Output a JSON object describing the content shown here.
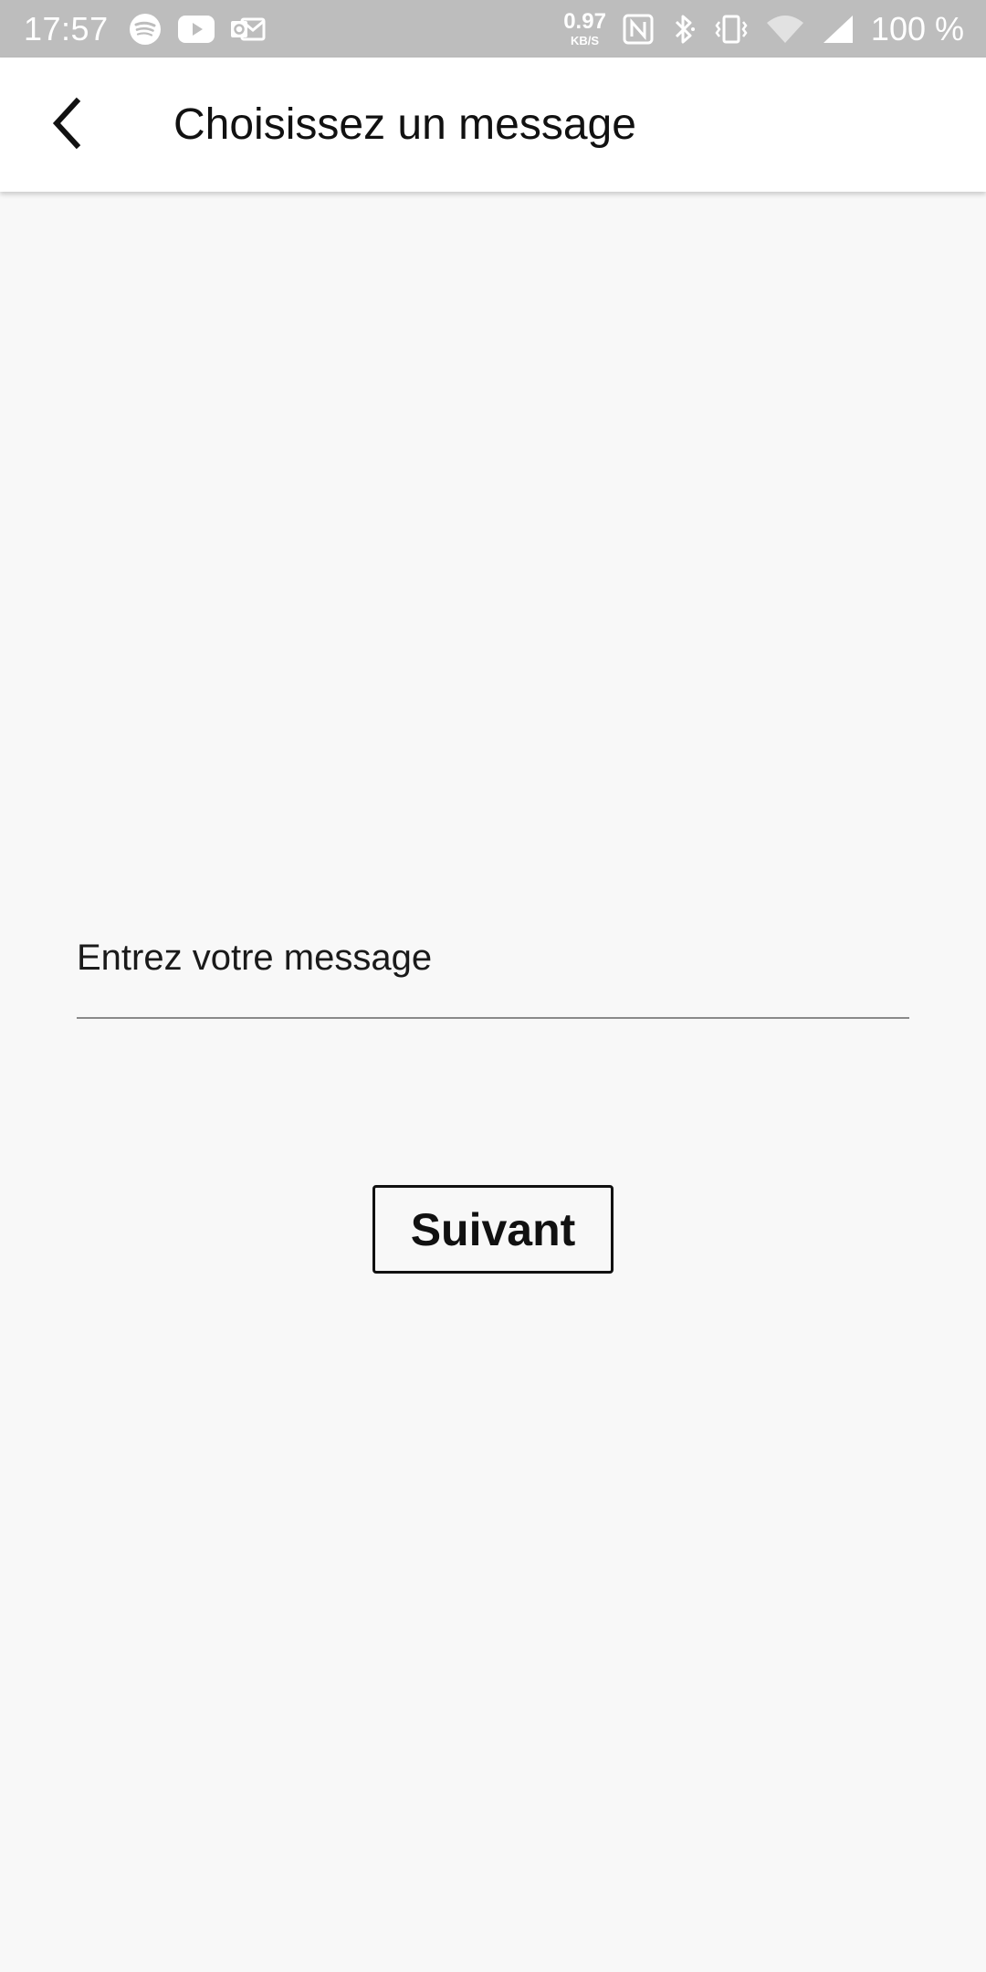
{
  "status_bar": {
    "time": "17:57",
    "left_icons": [
      "spotify-icon",
      "youtube-icon",
      "outlook-icon"
    ],
    "net_speed_value": "0.97",
    "net_speed_unit": "KB/S",
    "right_icons": [
      "nfc-icon",
      "bluetooth-icon",
      "vibrate-icon",
      "wifi-icon",
      "signal-icon"
    ],
    "battery": "100 %"
  },
  "app_bar": {
    "title": "Choisissez un message",
    "back_icon": "back-arrow-icon"
  },
  "form": {
    "message_placeholder": "Entrez votre message",
    "next_label": "Suivant"
  },
  "colors": {
    "status_bar_bg": "#bdbdbd",
    "page_bg": "#f8f8f8",
    "app_bar_bg": "#ffffff",
    "text": "#111111",
    "underline": "#8a8a8a"
  }
}
